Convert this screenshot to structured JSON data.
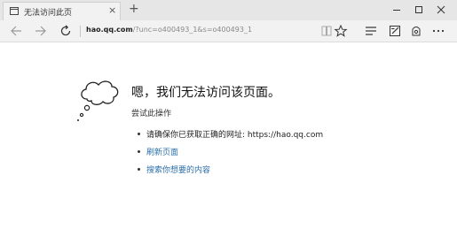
{
  "tab": {
    "title": "无法访问此页",
    "close": "×"
  },
  "newtab": "+",
  "address": {
    "host": "hao.qq.com",
    "path": "/?unc=o400493_1&s=o400493_1"
  },
  "content": {
    "heading": "嗯，我们无法访问该页面。",
    "subheading": "尝试此操作",
    "items": [
      {
        "label": "请确保你已获取正确的网址: https://hao.qq.com",
        "link": false
      },
      {
        "label": "刷新页面",
        "link": true
      },
      {
        "label": "搜索你想要的内容",
        "link": true
      }
    ]
  },
  "colors": {
    "link": "#2c6fa8",
    "tabbar": "#e6e6e6",
    "navbar": "#f2f2f2"
  }
}
